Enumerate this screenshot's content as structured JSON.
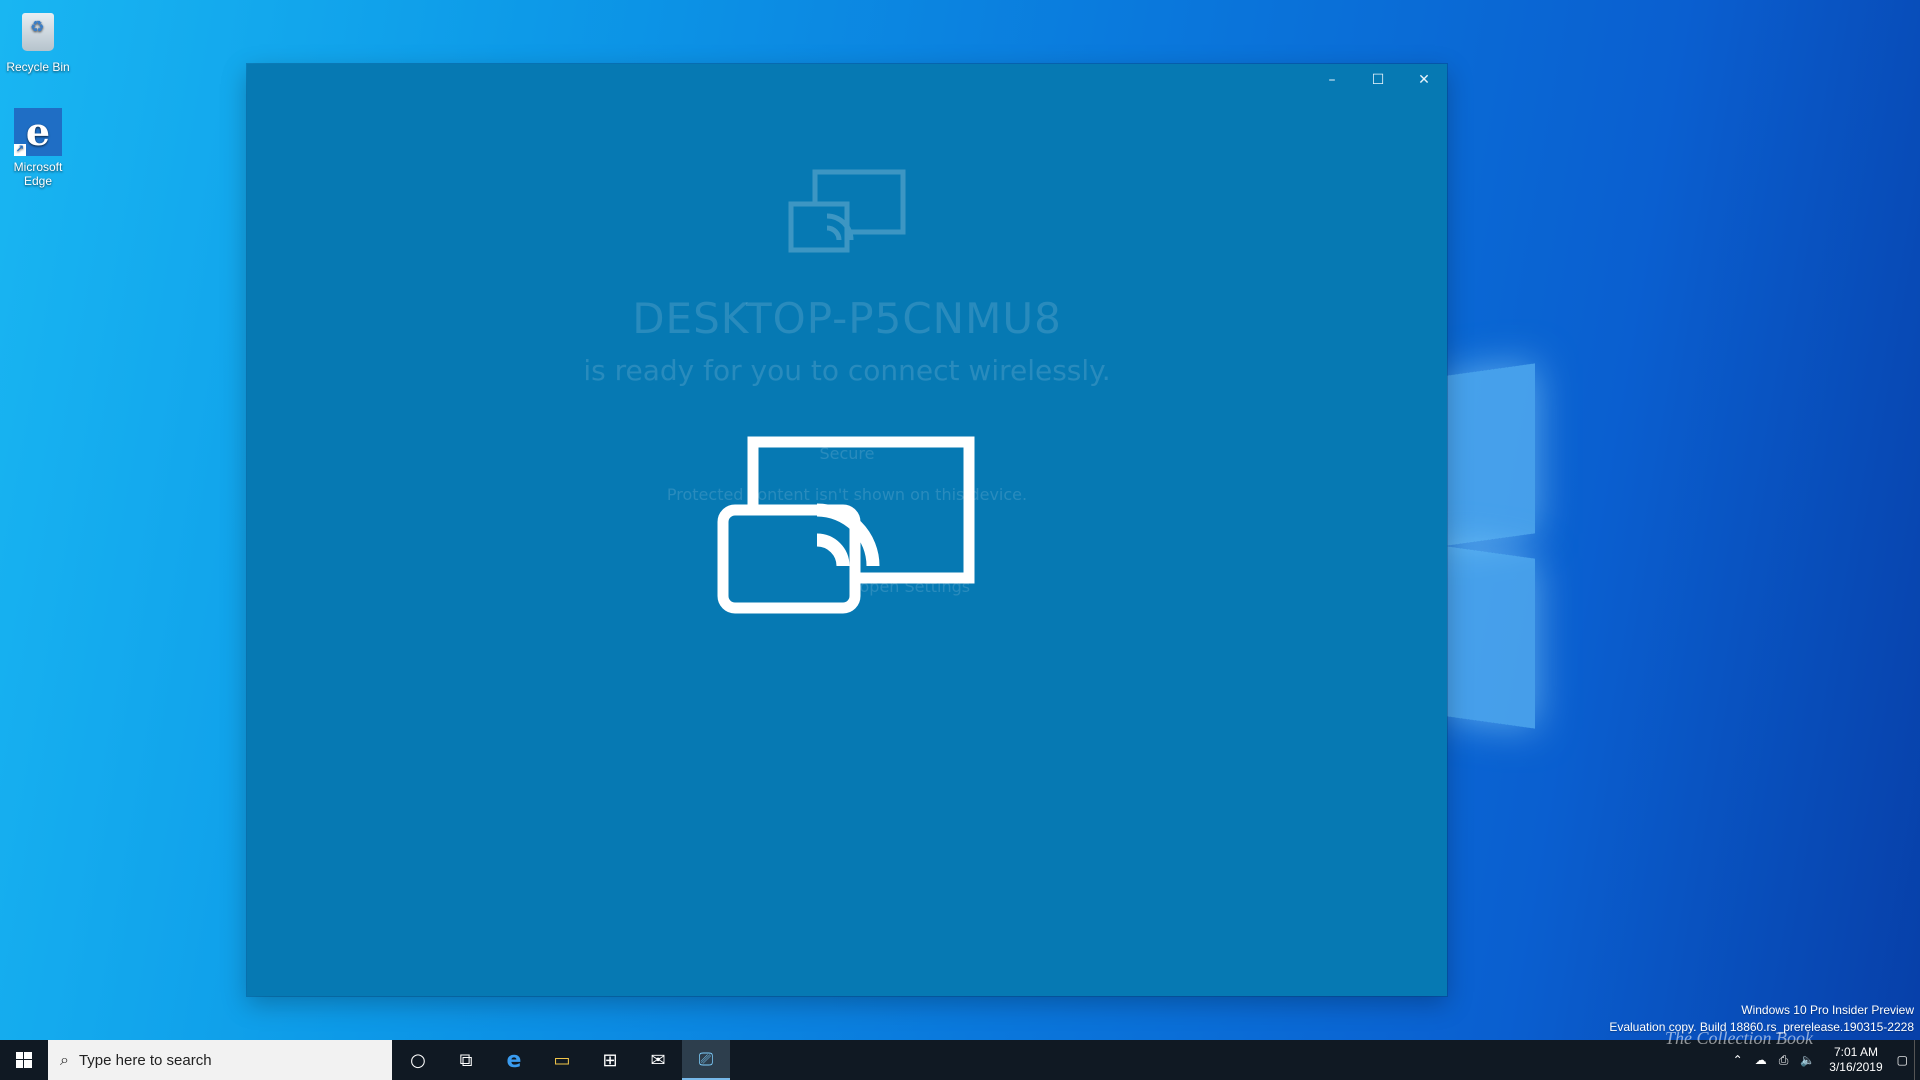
{
  "desktop": {
    "icons": [
      {
        "label": "Recycle Bin",
        "icon": "recycle-bin-icon"
      },
      {
        "label": "Microsoft Edge",
        "icon": "edge-icon"
      }
    ],
    "watermark": {
      "line1": "Windows 10 Pro Insider Preview",
      "line2": "Evaluation copy. Build 18860.rs_prerelease.190315-2228"
    },
    "brand_overlay": "The Collection Book"
  },
  "window": {
    "app": "Connect",
    "caption": {
      "minimize": "–",
      "maximize": "☐",
      "close": "✕"
    },
    "device_name": "DESKTOP-P5CNMU8",
    "ready_text": "is ready for you to connect wirelessly.",
    "secure_text": "Secure",
    "protected_text": "Protected content isn't shown on this device.",
    "hint_text": "Press Ctrl + S to open Settings"
  },
  "taskbar": {
    "start_icon": "windows-start-icon",
    "search_placeholder": "Type here to search",
    "pinned": [
      {
        "name": "cortana-button",
        "icon": "circle-icon",
        "glyph": "○"
      },
      {
        "name": "task-view-button",
        "icon": "task-view-icon",
        "glyph": "⧉"
      },
      {
        "name": "edge-taskbar-button",
        "icon": "edge-icon",
        "glyph": "e"
      },
      {
        "name": "file-explorer-button",
        "icon": "folder-icon",
        "glyph": "▭"
      },
      {
        "name": "store-button",
        "icon": "store-bag-icon",
        "glyph": "⊞"
      },
      {
        "name": "mail-button",
        "icon": "mail-icon",
        "glyph": "✉"
      },
      {
        "name": "connect-app-button",
        "icon": "connect-icon",
        "glyph": "⎚"
      }
    ],
    "tray": {
      "time": "7:01 AM",
      "date": "3/16/2019"
    }
  },
  "colors": {
    "window_bg": "#0679b3",
    "taskbar_bg": "#101923",
    "accent": "#77b9ea"
  }
}
